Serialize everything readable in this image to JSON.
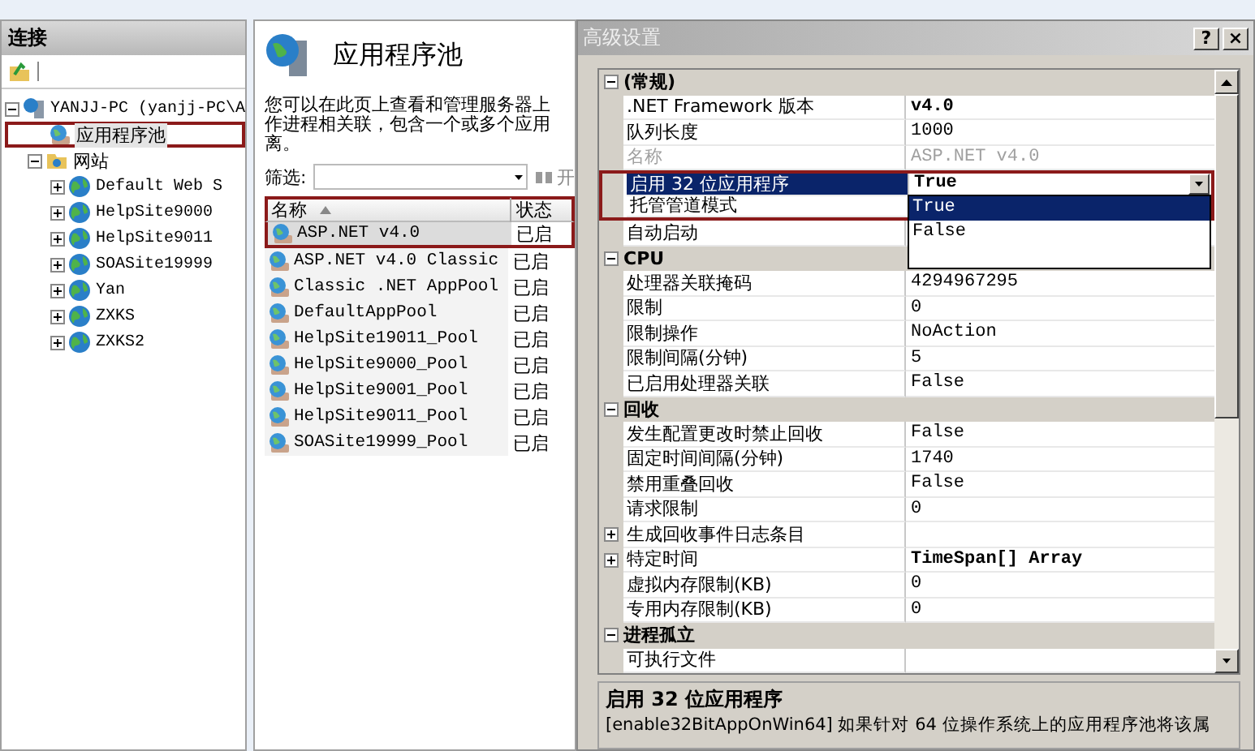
{
  "sidebar": {
    "title": "连接",
    "tree": [
      {
        "label": "YANJJ-PC (yanjj-PC\\A",
        "kind": "server",
        "expanded": true,
        "selected": false,
        "children": [
          {
            "label": "应用程序池",
            "kind": "pools",
            "selected": true,
            "highlighted": true
          },
          {
            "label": "网站",
            "kind": "folder",
            "expanded": true,
            "selected": false,
            "children": [
              {
                "label": "Default Web S",
                "kind": "site",
                "expanded": false,
                "selected": false
              },
              {
                "label": "HelpSite9000",
                "kind": "site",
                "expanded": false,
                "selected": false
              },
              {
                "label": "HelpSite9011",
                "kind": "site",
                "expanded": false,
                "selected": false
              },
              {
                "label": "SOASite19999",
                "kind": "site",
                "expanded": false,
                "selected": false
              },
              {
                "label": "Yan",
                "kind": "site",
                "expanded": false,
                "selected": false
              },
              {
                "label": "ZXKS",
                "kind": "site",
                "expanded": false,
                "selected": false
              },
              {
                "label": "ZXKS2",
                "kind": "site",
                "expanded": false,
                "selected": false
              }
            ]
          }
        ]
      }
    ]
  },
  "page": {
    "title": "应用程序池",
    "description": [
      "您可以在此页上查看和管理服务器上",
      "作进程相关联，包含一个或多个应用",
      "离。"
    ],
    "filter": {
      "label": "筛选:"
    },
    "go_button": "开",
    "table": {
      "columns": [
        {
          "label": "名称",
          "sorted": true
        },
        {
          "label": "状态",
          "sorted": false
        }
      ],
      "header_highlighted": true,
      "rows": [
        {
          "name": "ASP.NET v4.0",
          "status": "已启",
          "selected": true,
          "highlighted": true
        },
        {
          "name": "ASP.NET v4.0 Classic",
          "status": "已启",
          "selected": false
        },
        {
          "name": "Classic .NET AppPool",
          "status": "已启",
          "selected": false
        },
        {
          "name": "DefaultAppPool",
          "status": "已启",
          "selected": false
        },
        {
          "name": "HelpSite19011_Pool",
          "status": "已启",
          "selected": false
        },
        {
          "name": "HelpSite9000_Pool",
          "status": "已启",
          "selected": false
        },
        {
          "name": "HelpSite9001_Pool",
          "status": "已启",
          "selected": false
        },
        {
          "name": "HelpSite9011_Pool",
          "status": "已启",
          "selected": false
        },
        {
          "name": "SOASite19999_Pool",
          "status": "已启",
          "selected": false
        }
      ]
    }
  },
  "dialog": {
    "title": "高级设置",
    "help_button": "?",
    "close_button": "×",
    "properties": [
      {
        "kind": "category",
        "label": "(常规)",
        "expanded": true
      },
      {
        "kind": "property",
        "label": ".NET Framework 版本",
        "value": "v4.0",
        "bold": true,
        "disabled": false,
        "selected": false
      },
      {
        "kind": "property",
        "label": "队列长度",
        "value": "1000",
        "bold": false,
        "disabled": false,
        "selected": false
      },
      {
        "kind": "property",
        "label": "名称",
        "value": "ASP.NET v4.0",
        "bold": false,
        "disabled": true,
        "selected": false
      },
      {
        "kind": "property",
        "label": "启用 32 位应用程序",
        "value": "True",
        "bold": true,
        "disabled": false,
        "selected": true,
        "highlighted": true,
        "dropdown": [
          {
            "label": "True",
            "selected": true
          },
          {
            "label": "False",
            "selected": false
          }
        ]
      },
      {
        "kind": "property",
        "label": "托管管道模式",
        "disabled": false,
        "selected": false,
        "highlighted": true
      },
      {
        "kind": "property",
        "label": "自动启动",
        "disabled": false,
        "selected": false
      },
      {
        "kind": "category",
        "label": "CPU",
        "expanded": true
      },
      {
        "kind": "property",
        "label": "处理器关联掩码",
        "value": "4294967295",
        "bold": false,
        "disabled": false,
        "selected": false
      },
      {
        "kind": "property",
        "label": "限制",
        "value": "0",
        "bold": false,
        "disabled": false,
        "selected": false
      },
      {
        "kind": "property",
        "label": "限制操作",
        "value": "NoAction",
        "bold": false,
        "disabled": false,
        "selected": false
      },
      {
        "kind": "property",
        "label": "限制间隔(分钟)",
        "value": "5",
        "bold": false,
        "disabled": false,
        "selected": false
      },
      {
        "kind": "property",
        "label": "已启用处理器关联",
        "value": "False",
        "bold": false,
        "disabled": false,
        "selected": false
      },
      {
        "kind": "category",
        "label": "回收",
        "expanded": true
      },
      {
        "kind": "property",
        "label": "发生配置更改时禁止回收",
        "value": "False",
        "bold": false,
        "disabled": false,
        "selected": false
      },
      {
        "kind": "property",
        "label": "固定时间间隔(分钟)",
        "value": "1740",
        "bold": false,
        "disabled": false,
        "selected": false
      },
      {
        "kind": "property",
        "label": "禁用重叠回收",
        "value": "False",
        "bold": false,
        "disabled": false,
        "selected": false
      },
      {
        "kind": "property",
        "label": "请求限制",
        "value": "0",
        "bold": false,
        "disabled": false,
        "selected": false
      },
      {
        "kind": "property",
        "label": "生成回收事件日志条目",
        "expandable": true,
        "disabled": false,
        "selected": false
      },
      {
        "kind": "property",
        "label": "特定时间",
        "value": "TimeSpan[] Array",
        "expandable": true,
        "bold": true,
        "disabled": false,
        "selected": false
      },
      {
        "kind": "property",
        "label": "虚拟内存限制(KB)",
        "value": "0",
        "bold": false,
        "disabled": false,
        "selected": false
      },
      {
        "kind": "property",
        "label": "专用内存限制(KB)",
        "value": "0",
        "bold": false,
        "disabled": false,
        "selected": false
      },
      {
        "kind": "category",
        "label": "进程孤立",
        "expanded": true
      },
      {
        "kind": "property",
        "label": "可执行文件",
        "disabled": false,
        "selected": false
      }
    ],
    "help": {
      "title": "启用 32 位应用程序",
      "text": "[enable32BitAppOnWin64] 如果针对 64 位操作系统上的应用程序池将该属"
    }
  }
}
